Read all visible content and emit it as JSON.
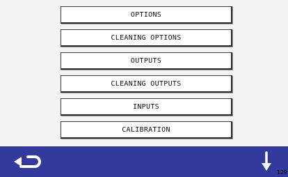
{
  "menu": {
    "items": [
      {
        "label": "OPTIONS"
      },
      {
        "label": "CLEANING OPTIONS"
      },
      {
        "label": "OUTPUTS"
      },
      {
        "label": "CLEANING OUTPUTS"
      },
      {
        "label": "INPUTS"
      },
      {
        "label": "CALIBRATION"
      }
    ]
  },
  "footer": {
    "back_icon": "return-arrow-icon",
    "down_icon": "down-arrow-icon",
    "page_number": "129"
  },
  "colors": {
    "background": "#f3f3f5",
    "footer_bar": "#323b9b",
    "button_face": "#ffffff",
    "button_border": "#2a2a2a",
    "icon": "#ffffff"
  }
}
